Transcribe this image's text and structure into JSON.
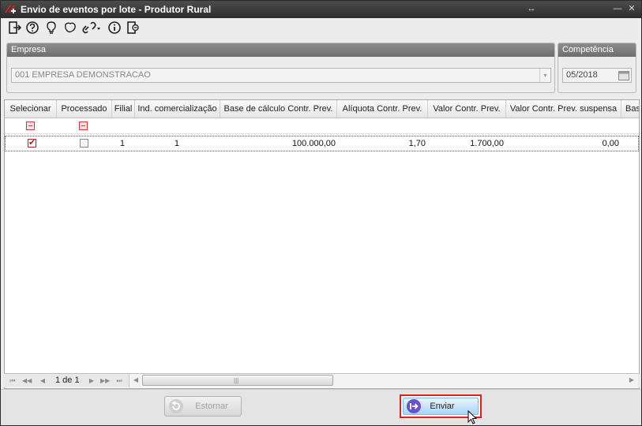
{
  "window": {
    "title": "Envio de eventos por lote - Produtor Rural"
  },
  "toolbar": {
    "icons": [
      "exit-icon",
      "help-icon",
      "lightbulb-icon",
      "map-icon",
      "link-icon",
      "info-icon",
      "logout-icon"
    ]
  },
  "empresa": {
    "label": "Empresa",
    "value": "001 EMPRESA DEMONSTRACAO"
  },
  "competencia": {
    "label": "Competência",
    "value": "05/2018"
  },
  "grid": {
    "columns": [
      "Selecionar",
      "Processado",
      "Filial",
      "Ind. comercialização",
      "Base de cálculo Contr. Prev.",
      "Alíquota Contr. Prev.",
      "Valor Contr. Prev.",
      "Valor Contr. Prev. suspensa",
      "Bas"
    ],
    "rows": [
      {
        "selecionar": true,
        "processado": false,
        "filial": "1",
        "ind_comercializacao": "1",
        "base_calculo": "100.000,00",
        "aliquota": "1,70",
        "valor_contr": "1.700,00",
        "valor_suspensa": "0,00"
      }
    ]
  },
  "pager": {
    "text": "1 de 1"
  },
  "buttons": {
    "estornar": "Estornar",
    "enviar": "Enviar"
  }
}
